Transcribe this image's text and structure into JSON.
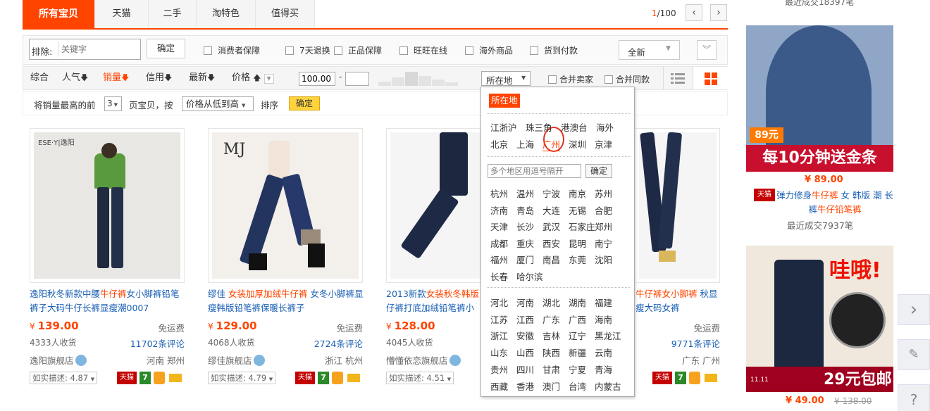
{
  "tabs": [
    "所有宝贝",
    "天猫",
    "二手",
    "淘特色",
    "值得买"
  ],
  "pager": {
    "current": "1",
    "total": "/100",
    "prev": "‹",
    "next": "›"
  },
  "filter": {
    "exclude_label": "排除:",
    "keyword_placeholder": "关键字",
    "confirm": "确定",
    "checks": [
      "消费者保障",
      "7天退换",
      "正品保障",
      "旺旺在线",
      "海外商品",
      "货到付款"
    ],
    "condition": "全新"
  },
  "sort": {
    "items": [
      "综合",
      "人气",
      "销量",
      "信用",
      "最新",
      "价格"
    ],
    "price_min": "100.00",
    "price_sep": "-",
    "price_max": "",
    "location": "所在地",
    "merge_sellers": "合并卖家",
    "merge_same": "合并同款"
  },
  "rank": {
    "prefix": "将销量最高的前",
    "count": "3",
    "middle": "页宝贝，按",
    "order": "价格从低到高",
    "suffix": "排序",
    "confirm": "确定"
  },
  "location_dropdown": {
    "header": "所在地",
    "row1": [
      "江浙沪",
      "珠三角",
      "港澳台",
      "海外"
    ],
    "row2": [
      "北京",
      "上海",
      "广州",
      "深圳",
      "京津"
    ],
    "multi_placeholder": "多个地区用逗号隔开",
    "confirm": "确定",
    "cities": [
      "杭州",
      "温州",
      "宁波",
      "南京",
      "苏州",
      "济南",
      "青岛",
      "大连",
      "无锡",
      "合肥",
      "天津",
      "长沙",
      "武汉",
      "石家庄",
      "郑州",
      "成都",
      "重庆",
      "西安",
      "昆明",
      "南宁",
      "福州",
      "厦门",
      "南昌",
      "东莞",
      "沈阳",
      "长春",
      "哈尔滨"
    ],
    "provinces": [
      "河北",
      "河南",
      "湖北",
      "湖南",
      "福建",
      "江苏",
      "江西",
      "广东",
      "广西",
      "海南",
      "浙江",
      "安徽",
      "吉林",
      "辽宁",
      "黑龙江",
      "山东",
      "山西",
      "陕西",
      "新疆",
      "云南",
      "贵州",
      "四川",
      "甘肃",
      "宁夏",
      "青海",
      "西藏",
      "香港",
      "澳门",
      "台湾",
      "内蒙古"
    ]
  },
  "products": [
    {
      "title_a": "逸阳秋冬新款中腰",
      "title_b": "牛仔裤",
      "title_c": "女小脚裤铅笔裤子大码牛仔长裤显瘦潮0007",
      "currency": "¥",
      "price": "139.00",
      "shipping": "免运费",
      "sales": "4333人收货",
      "reviews": "11702条评论",
      "shop": "逸阳旗舰店",
      "location": "河南 郑州",
      "desc": "如实描述: 4.87",
      "brand": "ESE·Y|逸阳"
    },
    {
      "title_a": "缪佳 ",
      "title_b": "女装加厚加绒牛仔裤",
      "title_c": " 女冬小脚裤显瘦韩版铅笔裤保暖长裤子",
      "currency": "¥",
      "price": "129.00",
      "shipping": "免运费",
      "sales": "4068人收货",
      "reviews": "2724条评论",
      "shop": "缪佳旗舰店",
      "location": "浙江 杭州",
      "desc": "如实描述: 4.79",
      "brand": "MJ"
    },
    {
      "title_a": "2013新款",
      "title_b": "女装秋冬韩版",
      "title_c": "仔裤打底加绒铅笔裤小脚裤",
      "currency": "¥",
      "price": "128.00",
      "shipping": "免运费",
      "sales": "4045人收货",
      "reviews": "",
      "shop": "懵懂依恋旗舰店",
      "location": "",
      "desc": "如实描述: 4.51",
      "brand": ""
    },
    {
      "title_a": "",
      "title_b": "牛仔裤女小脚裤",
      "title_c": " 秋显瘦大码女裤",
      "currency": "",
      "price": "",
      "shipping": "免运费",
      "sales": "",
      "reviews": "9771条评论",
      "shop": "",
      "location": "广东 广州",
      "desc": "",
      "brand": ""
    }
  ],
  "sidebar": {
    "top_text": "最近成交18397笔",
    "ad1_price_tag": "89元",
    "ad1_banner": "每10分钟送金条",
    "item1_price": "¥ 89.00",
    "item1_title_a": "弹力修身",
    "item1_title_b": "牛仔裤",
    "item1_title_c": " 女 韩版 潮 长裤",
    "item1_title_d": "牛仔铅笔裤",
    "item1_sales": "最近成交7937笔",
    "ad2_text": "哇哦!",
    "ad2_price": "29元包邮",
    "ad2_event": "11.11",
    "item2_price": "¥ 49.00",
    "item2_orig": "¥ 138.00"
  },
  "tmall_label": "天猫",
  "tag_seven": "7",
  "float_buttons": [
    "›",
    "✎",
    "?"
  ]
}
